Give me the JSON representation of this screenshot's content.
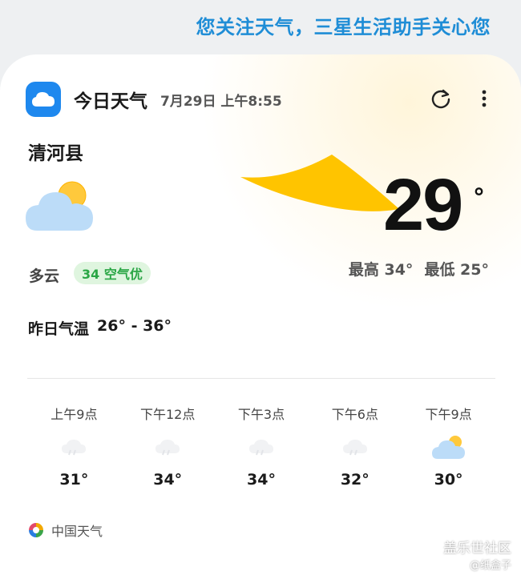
{
  "banner": "您关注天气，三星生活助手关心您",
  "header": {
    "title": "今日天气",
    "date": "7月29日 上午8:55",
    "icons": {
      "app": "cloud-icon",
      "refresh": "refresh-icon",
      "menu": "more-vertical-icon"
    }
  },
  "city": "清河县",
  "current": {
    "temp": "29",
    "degree": "°",
    "condition": "多云",
    "condition_icon": "partly-cloudy-icon",
    "aqi": "34 空气优",
    "high": "最高 34°",
    "low": "最低 25°"
  },
  "yesterday": {
    "label": "昨日气温",
    "range": "26° - 36°"
  },
  "hourly": [
    {
      "time": "上午9点",
      "temp": "31°",
      "icon": "faint-rain-icon"
    },
    {
      "time": "下午12点",
      "temp": "34°",
      "icon": "faint-rain-icon"
    },
    {
      "time": "下午3点",
      "temp": "34°",
      "icon": "faint-rain-icon"
    },
    {
      "time": "下午6点",
      "temp": "32°",
      "icon": "faint-rain-icon"
    },
    {
      "time": "下午9点",
      "temp": "30°",
      "icon": "partly-cloudy-icon"
    }
  ],
  "source": "中国天气",
  "watermark": {
    "site": "盖乐世社区",
    "author": "@纸盒子"
  },
  "colors": {
    "accent": "#1f8dd6",
    "app_icon": "#1e88ee",
    "sun": "#ffc400",
    "aqi_good": "#2aa645"
  }
}
